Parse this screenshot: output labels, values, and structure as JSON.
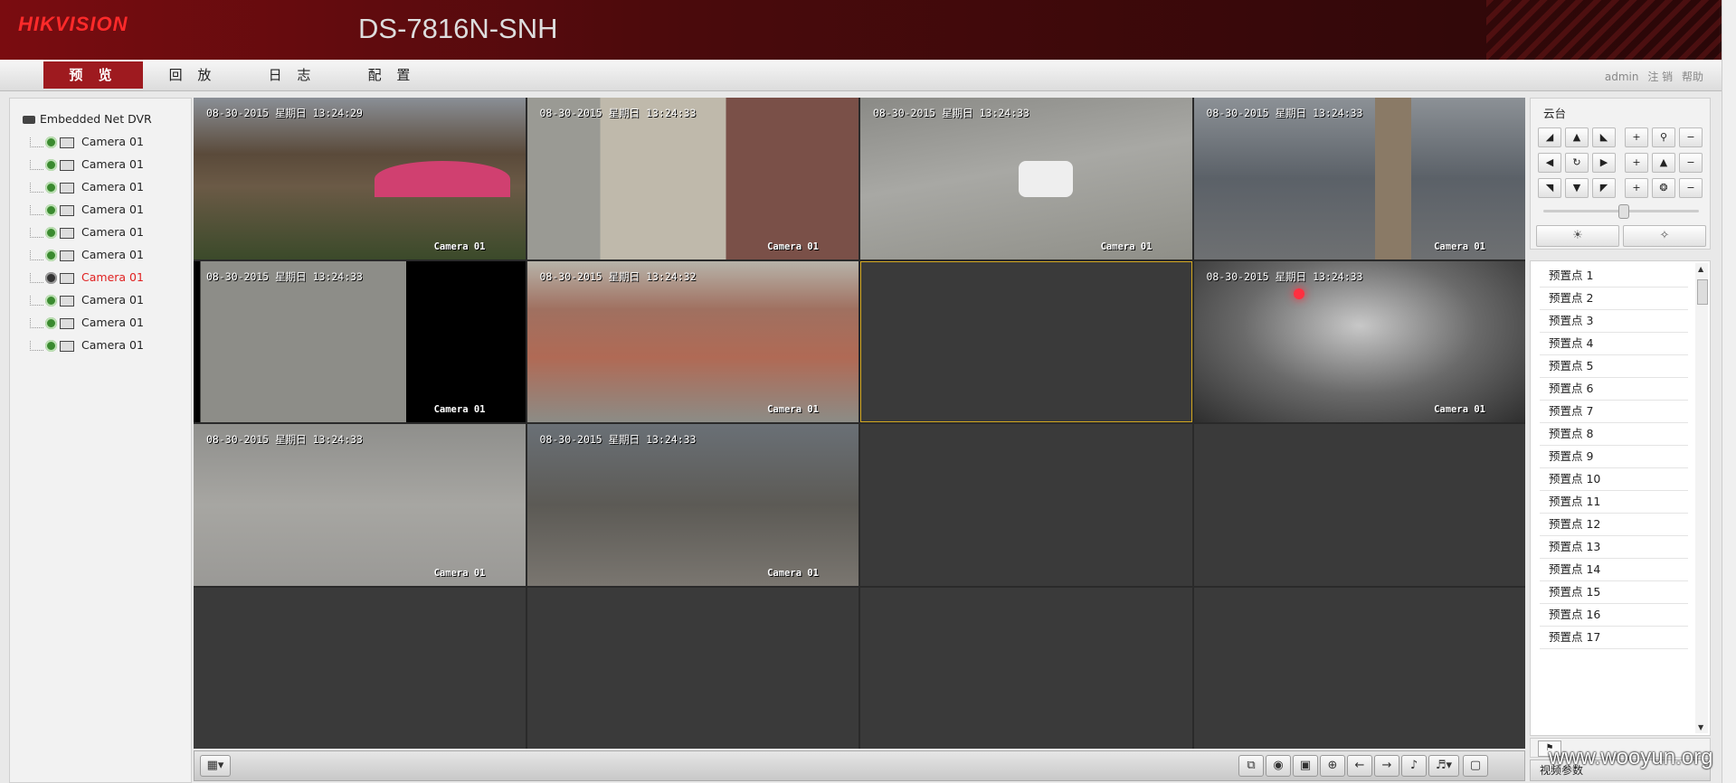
{
  "header": {
    "logo": "HIKVISION",
    "model": "DS-7816N-SNH"
  },
  "menu": {
    "tabs": [
      "预 览",
      "回 放",
      "日 志",
      "配 置"
    ],
    "active_index": 0
  },
  "user_links": {
    "user": "admin",
    "logout": "注 销",
    "help": "帮助"
  },
  "tree": {
    "root": "Embedded Net DVR",
    "cameras": [
      "Camera 01",
      "Camera 01",
      "Camera 01",
      "Camera 01",
      "Camera 01",
      "Camera 01",
      "Camera 01",
      "Camera 01",
      "Camera 01",
      "Camera 01"
    ],
    "selected_index": 6
  },
  "video_tiles": [
    {
      "timestamp": "08-30-2015 星期日 13:24:29",
      "camera": "Camera 01"
    },
    {
      "timestamp": "08-30-2015 星期日 13:24:33",
      "camera": "Camera 01"
    },
    {
      "timestamp": "08-30-2015 星期日 13:24:33",
      "camera": "Camera 01"
    },
    {
      "timestamp": "08-30-2015 星期日 13:24:33",
      "camera": "Camera 01"
    },
    {
      "timestamp": "08-30-2015 星期日 13:24:33",
      "camera": "Camera 01"
    },
    {
      "timestamp": "08-30-2015 星期日 13:24:32",
      "camera": "Camera 01"
    },
    {
      "timestamp": "",
      "camera": ""
    },
    {
      "timestamp": "08-30-2015 星期日 13:24:33",
      "camera": "Camera 01"
    },
    {
      "timestamp": "08-30-2015 星期日 13:24:33",
      "camera": "Camera 01"
    },
    {
      "timestamp": "08-30-2015 星期日 13:24:33",
      "camera": "Camera 01"
    }
  ],
  "ptz": {
    "title": "云台"
  },
  "presets": [
    "预置点 1",
    "预置点 2",
    "预置点 3",
    "预置点 4",
    "预置点 5",
    "预置点 6",
    "预置点 7",
    "预置点 8",
    "预置点 9",
    "预置点 10",
    "预置点 11",
    "预置点 12",
    "预置点 13",
    "预置点 14",
    "预置点 15",
    "预置点 16",
    "预置点 17"
  ],
  "video_params": {
    "label": "视频参数"
  },
  "watermark": "www.wooyun.org",
  "colors": {
    "brand_red": "#9e1a1f",
    "selected_camera": "#e02020",
    "selected_tile_border": "#d4a820"
  }
}
